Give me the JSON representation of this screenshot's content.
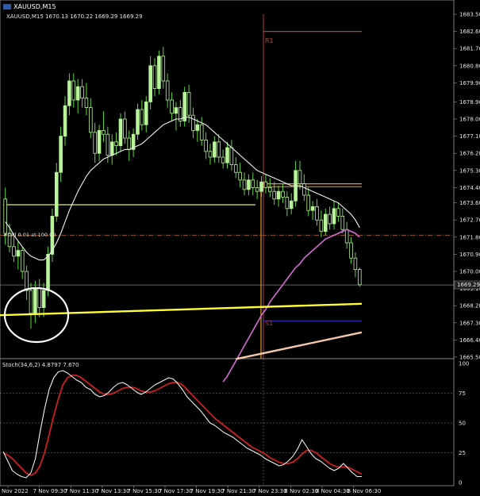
{
  "header": {
    "symbol": "XAUUSD,M15",
    "ohlc": "XAUUSD,M15  1670.13 1670.22 1669.29 1669.29"
  },
  "stochastic": {
    "label": "Stoch(34,6,2) 4.8797 7.670"
  },
  "annotations": {
    "trade_label": "#sell 0.01 at 100.00",
    "r1_label": "R1",
    "s1_label": "S1"
  },
  "chart_data": {
    "type": "candlestick",
    "symbol": "XAUUSD",
    "timeframe": "M15",
    "current_price": 1669.29,
    "current_price_label": "1669.29",
    "ylim": [
      1665.5,
      1683.5
    ],
    "price_ticks": [
      "1683.50",
      "1682.60",
      "1681.70",
      "1680.80",
      "1679.90",
      "1678.90",
      "1678.00",
      "1677.10",
      "1676.20",
      "1675.30",
      "1674.40",
      "1673.60",
      "1672.70",
      "1671.80",
      "1670.90",
      "1670.00",
      "1669.10",
      "1668.20",
      "1667.30",
      "1666.40",
      "1665.50"
    ],
    "time_labels": [
      "Nov 2022",
      "7 Nov 09:30",
      "7 Nov 11:30",
      "7 Nov 13:30",
      "7 Nov 15:30",
      "7 Nov 17:30",
      "7 Nov 19:30",
      "7 Nov 21:30",
      "7 Nov 23:30",
      "8 Nov 02:30",
      "8 Nov 04:30",
      "8 Nov 06:30"
    ],
    "candles": [
      [
        1673.8,
        1674.4,
        1671.4,
        1672.0
      ],
      [
        1672.0,
        1672.5,
        1671.0,
        1671.3
      ],
      [
        1671.3,
        1671.9,
        1670.5,
        1670.8
      ],
      [
        1670.8,
        1671.6,
        1670.1,
        1671.1
      ],
      [
        1671.1,
        1671.3,
        1669.6,
        1670.0
      ],
      [
        1670.0,
        1670.3,
        1668.5,
        1669.0
      ],
      [
        1669.0,
        1669.4,
        1667.0,
        1667.8
      ],
      [
        1667.8,
        1669.5,
        1667.3,
        1669.1
      ],
      [
        1669.1,
        1669.6,
        1667.6,
        1668.1
      ],
      [
        1668.1,
        1669.4,
        1667.6,
        1669.0
      ],
      [
        1669.0,
        1671.3,
        1668.7,
        1670.9
      ],
      [
        1670.9,
        1673.3,
        1670.5,
        1672.9
      ],
      [
        1672.9,
        1675.7,
        1672.6,
        1675.2
      ],
      [
        1675.2,
        1677.6,
        1674.7,
        1677.1
      ],
      [
        1677.1,
        1679.2,
        1676.6,
        1678.7
      ],
      [
        1678.7,
        1680.4,
        1678.2,
        1680.0
      ],
      [
        1680.0,
        1680.4,
        1678.6,
        1679.0
      ],
      [
        1679.0,
        1680.1,
        1678.3,
        1679.7
      ],
      [
        1679.7,
        1680.1,
        1678.6,
        1679.1
      ],
      [
        1679.1,
        1679.9,
        1678.2,
        1678.6
      ],
      [
        1678.6,
        1679.1,
        1677.0,
        1677.3
      ],
      [
        1677.3,
        1677.8,
        1675.7,
        1676.2
      ],
      [
        1676.2,
        1677.7,
        1675.8,
        1677.4
      ],
      [
        1677.4,
        1678.4,
        1676.8,
        1677.2
      ],
      [
        1677.2,
        1677.6,
        1675.7,
        1676.1
      ],
      [
        1676.1,
        1677.2,
        1675.6,
        1676.8
      ],
      [
        1676.8,
        1677.3,
        1676.1,
        1676.6
      ],
      [
        1676.6,
        1678.3,
        1676.3,
        1678.0
      ],
      [
        1678.0,
        1678.4,
        1676.7,
        1677.0
      ],
      [
        1677.0,
        1677.4,
        1675.8,
        1676.4
      ],
      [
        1676.4,
        1677.5,
        1676.0,
        1677.2
      ],
      [
        1677.2,
        1678.8,
        1676.9,
        1678.5
      ],
      [
        1678.5,
        1679.0,
        1677.4,
        1677.7
      ],
      [
        1677.7,
        1679.2,
        1677.3,
        1678.9
      ],
      [
        1678.9,
        1681.3,
        1678.5,
        1680.8
      ],
      [
        1680.8,
        1681.2,
        1679.2,
        1679.6
      ],
      [
        1679.6,
        1681.6,
        1679.3,
        1681.3
      ],
      [
        1681.3,
        1681.8,
        1679.6,
        1680.0
      ],
      [
        1680.0,
        1680.4,
        1678.6,
        1679.0
      ],
      [
        1679.0,
        1679.4,
        1677.9,
        1678.3
      ],
      [
        1678.3,
        1678.9,
        1677.4,
        1678.6
      ],
      [
        1678.6,
        1679.0,
        1677.6,
        1677.9
      ],
      [
        1677.9,
        1679.7,
        1677.6,
        1679.4
      ],
      [
        1679.4,
        1679.8,
        1677.8,
        1678.2
      ],
      [
        1678.2,
        1678.6,
        1677.0,
        1677.4
      ],
      [
        1677.4,
        1678.0,
        1676.8,
        1677.7
      ],
      [
        1677.7,
        1678.1,
        1676.6,
        1676.9
      ],
      [
        1676.9,
        1677.3,
        1675.9,
        1676.3
      ],
      [
        1676.3,
        1676.7,
        1675.6,
        1676.0
      ],
      [
        1676.0,
        1677.1,
        1675.7,
        1676.8
      ],
      [
        1676.8,
        1677.2,
        1675.7,
        1676.0
      ],
      [
        1676.0,
        1676.4,
        1675.4,
        1675.7
      ],
      [
        1675.7,
        1676.8,
        1675.4,
        1676.5
      ],
      [
        1676.5,
        1676.9,
        1675.3,
        1675.6
      ],
      [
        1675.6,
        1676.0,
        1674.9,
        1675.2
      ],
      [
        1675.2,
        1675.7,
        1674.4,
        1674.8
      ],
      [
        1674.8,
        1675.2,
        1674.0,
        1674.3
      ],
      [
        1674.3,
        1675.1,
        1674.0,
        1674.8
      ],
      [
        1674.8,
        1675.2,
        1674.0,
        1674.4
      ],
      [
        1674.4,
        1674.8,
        1673.8,
        1674.2
      ],
      [
        1674.2,
        1675.0,
        1673.9,
        1674.7
      ],
      [
        1674.7,
        1675.1,
        1674.1,
        1674.4
      ],
      [
        1674.4,
        1674.9,
        1673.9,
        1674.2
      ],
      [
        1674.2,
        1674.7,
        1673.5,
        1673.8
      ],
      [
        1673.8,
        1674.5,
        1673.4,
        1674.2
      ],
      [
        1674.2,
        1674.6,
        1673.6,
        1673.9
      ],
      [
        1673.9,
        1674.2,
        1672.9,
        1673.3
      ],
      [
        1673.3,
        1674.1,
        1673.0,
        1673.7
      ],
      [
        1673.7,
        1675.8,
        1673.4,
        1675.3
      ],
      [
        1675.3,
        1675.8,
        1674.3,
        1674.6
      ],
      [
        1674.6,
        1675.1,
        1673.7,
        1674.0
      ],
      [
        1674.0,
        1674.4,
        1672.9,
        1673.2
      ],
      [
        1673.2,
        1673.7,
        1672.7,
        1673.4
      ],
      [
        1673.4,
        1673.8,
        1672.4,
        1672.7
      ],
      [
        1672.7,
        1673.2,
        1671.8,
        1672.1
      ],
      [
        1672.1,
        1673.3,
        1671.9,
        1673.0
      ],
      [
        1673.0,
        1673.4,
        1672.2,
        1672.5
      ],
      [
        1672.5,
        1673.7,
        1672.2,
        1673.3
      ],
      [
        1673.3,
        1673.6,
        1672.6,
        1672.9
      ],
      [
        1672.9,
        1673.3,
        1672.0,
        1672.2
      ],
      [
        1672.2,
        1672.6,
        1671.2,
        1671.5
      ],
      [
        1671.5,
        1671.8,
        1670.4,
        1670.7
      ],
      [
        1670.7,
        1671.0,
        1669.7,
        1670.1
      ],
      [
        1670.1,
        1670.2,
        1669.2,
        1669.3
      ]
    ],
    "overlays": {
      "ma_fast_white": [
        1672.6,
        1672.3,
        1671.9,
        1671.6,
        1671.3,
        1671.0,
        1670.8,
        1670.7,
        1670.6,
        1670.6,
        1670.8,
        1671.1,
        1671.5,
        1672.0,
        1672.6,
        1673.2,
        1673.7,
        1674.2,
        1674.6,
        1675.0,
        1675.3,
        1675.5,
        1675.7,
        1675.9,
        1676.0,
        1676.1,
        1676.2,
        1676.3,
        1676.4,
        1676.4,
        1676.5,
        1676.6,
        1676.7,
        1676.9,
        1677.1,
        1677.3,
        1677.5,
        1677.7,
        1677.8,
        1677.9,
        1678.0,
        1678.0,
        1678.1,
        1678.1,
        1678.0,
        1677.9,
        1677.8,
        1677.7,
        1677.5,
        1677.3,
        1677.1,
        1676.9,
        1676.7,
        1676.5,
        1676.3,
        1676.1,
        1675.9,
        1675.7,
        1675.5,
        1675.3,
        1675.2,
        1675.1,
        1675.0,
        1674.9,
        1674.8,
        1674.7,
        1674.6,
        1674.5,
        1674.5,
        1674.5,
        1674.4,
        1674.3,
        1674.2,
        1674.1,
        1674.0,
        1673.9,
        1673.8,
        1673.7,
        1673.6,
        1673.4,
        1673.2,
        1673.0,
        1672.7,
        1672.3
      ],
      "ma_slow_pink": [
        1664.2,
        1664.5,
        1664.9,
        1665.3,
        1665.7,
        1666.1,
        1666.5,
        1666.9,
        1667.3,
        1667.7,
        1668.0,
        1668.4,
        1668.7,
        1669.0,
        1669.3,
        1669.6,
        1669.9,
        1670.2,
        1670.4,
        1670.7,
        1670.9,
        1671.1,
        1671.3,
        1671.5,
        1671.7,
        1671.8,
        1671.9,
        1672.0,
        1672.1,
        1672.2,
        1672.1,
        1672.0,
        1671.8
      ],
      "ma_slow_pink_start_index": 51,
      "ma_trend_yellow": [
        1667.7,
        1668.3
      ],
      "ma_orange": [
        1665.4,
        1666.8
      ],
      "ma_orange_start_index": 54,
      "hline_yellow_thin": 1673.5,
      "hline_dashdot_brown": 1671.9,
      "hline_gray_current": 1669.29,
      "r1": 1682.6,
      "s1": 1667.4,
      "orange_box_top": 1674.6,
      "orange_box_bottom": 1674.45
    },
    "stochastic": {
      "ylim": [
        0,
        100
      ],
      "levels": [
        25,
        50,
        75
      ],
      "tick_labels": [
        "100",
        "75",
        "50",
        "25",
        "0"
      ],
      "main_white": [
        26,
        18,
        10,
        7,
        5,
        4,
        8,
        20,
        42,
        62,
        78,
        88,
        93,
        94,
        92,
        89,
        86,
        84,
        80,
        78,
        74,
        72,
        73,
        76,
        80,
        83,
        84,
        82,
        79,
        76,
        74,
        76,
        79,
        82,
        84,
        86,
        88,
        87,
        83,
        78,
        72,
        68,
        64,
        60,
        55,
        50,
        48,
        45,
        42,
        40,
        38,
        35,
        32,
        29,
        27,
        25,
        23,
        20,
        18,
        16,
        14,
        15,
        18,
        22,
        28,
        36,
        30,
        24,
        20,
        18,
        15,
        12,
        10,
        12,
        16,
        12,
        8,
        5,
        5
      ],
      "signal_red": [
        25,
        23,
        20,
        16,
        12,
        8,
        6,
        8,
        14,
        25,
        40,
        56,
        70,
        82,
        88,
        90,
        90,
        88,
        85,
        82,
        79,
        76,
        74,
        74,
        75,
        77,
        79,
        80,
        80,
        79,
        77,
        76,
        76,
        77,
        79,
        81,
        83,
        84,
        84,
        82,
        78,
        74,
        70,
        66,
        62,
        58,
        54,
        51,
        48,
        45,
        42,
        39,
        36,
        33,
        30,
        28,
        26,
        24,
        21,
        19,
        17,
        16,
        16,
        17,
        20,
        24,
        27,
        27,
        25,
        22,
        19,
        16,
        14,
        13,
        13,
        13,
        11,
        9,
        7
      ]
    }
  }
}
